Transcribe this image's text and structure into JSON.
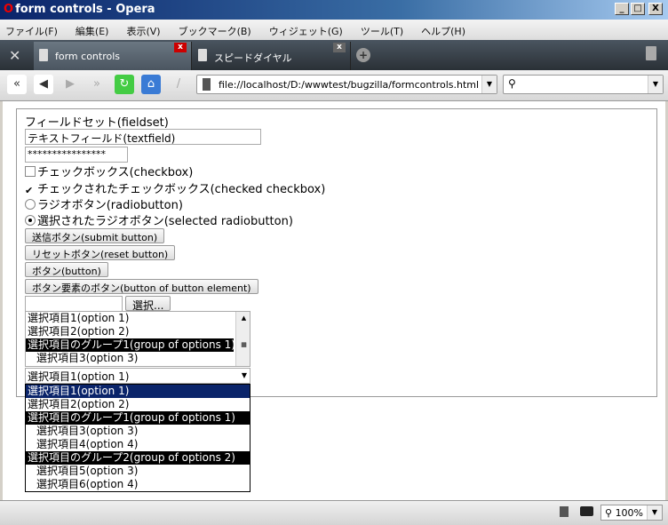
{
  "window": {
    "title": "form controls - Opera",
    "minimize": "_",
    "maximize": "□",
    "close": "X"
  },
  "menu": [
    "ファイル(F)",
    "編集(E)",
    "表示(V)",
    "ブックマーク(B)",
    "ウィジェット(G)",
    "ツール(T)",
    "ヘルプ(H)"
  ],
  "tabs": [
    {
      "label": "form controls",
      "close": "x"
    },
    {
      "label": "スピードダイヤル",
      "close": "x"
    }
  ],
  "toolbar": {
    "address": "file://localhost/D:/wwwtest/bugzilla/formcontrols.html",
    "search_placeholder": ""
  },
  "form": {
    "legend": "フィールドセット(fieldset)",
    "textfield": "テキストフィールド(textfield)",
    "password": "****************",
    "checkbox": "チェックボックス(checkbox)",
    "checked_checkbox": "チェックされたチェックボックス(checked checkbox)",
    "radio": "ラジオボタン(radiobutton)",
    "selected_radio": "選択されたラジオボタン(selected radiobutton)",
    "submit": "送信ボタン(submit button)",
    "reset": "リセットボタン(reset button)",
    "button": "ボタン(button)",
    "button_element": "ボタン要素のボタン(button of button element)",
    "file_browse": "選択...",
    "listbox": [
      "選択項目1(option 1)",
      "選択項目2(option 2)",
      "選択項目のグループ1(group of options 1)",
      "選択項目3(option 3)"
    ],
    "select_value": "選択項目1(option 1)",
    "dropdown": [
      "選択項目1(option 1)",
      "選択項目2(option 2)",
      "選択項目のグループ1(group of options 1)",
      "選択項目3(option 3)",
      "選択項目4(option 4)",
      "選択項目のグループ2(group of options 2)",
      "選択項目5(option 3)",
      "選択項目6(option 4)"
    ]
  },
  "status": {
    "zoom": "100%"
  }
}
